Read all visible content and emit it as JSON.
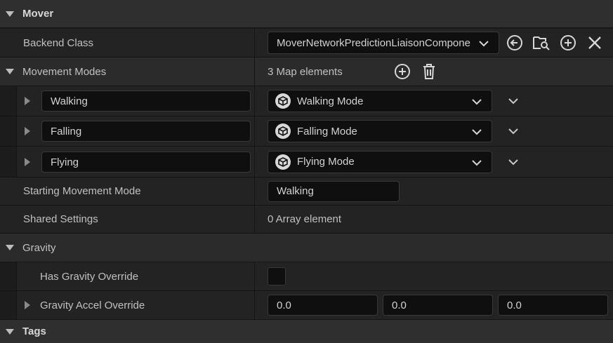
{
  "sections": {
    "mover": "Mover",
    "gravity": "Gravity",
    "tags": "Tags"
  },
  "backend_class": {
    "label": "Backend Class",
    "value": "MoverNetworkPredictionLiaisonComponent"
  },
  "movement_modes": {
    "label": "Movement Modes",
    "count_text": "3 Map elements",
    "entries": [
      {
        "key": "Walking",
        "value": "Walking Mode"
      },
      {
        "key": "Falling",
        "value": "Falling Mode"
      },
      {
        "key": "Flying",
        "value": "Flying Mode"
      }
    ]
  },
  "starting_movement_mode": {
    "label": "Starting Movement Mode",
    "value": "Walking"
  },
  "shared_settings": {
    "label": "Shared Settings",
    "value": "0 Array element"
  },
  "has_gravity_override": {
    "label": "Has Gravity Override",
    "checked": false
  },
  "gravity_accel_override": {
    "label": "Gravity Accel Override",
    "x": "0.0",
    "y": "0.0",
    "z": "0.0"
  },
  "icons": {
    "browse": "arrow-left-circle-icon",
    "find": "folder-search-icon",
    "add": "plus-circle-icon",
    "clear": "close-icon",
    "delete": "trash-icon",
    "mode": "cube-icon"
  }
}
